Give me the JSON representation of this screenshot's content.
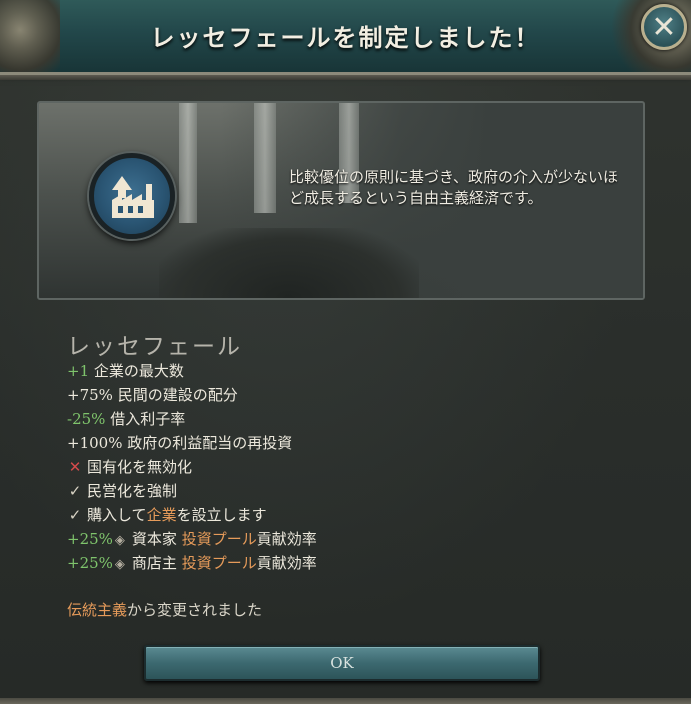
{
  "header": {
    "title": "レッセフェールを制定しました！",
    "close_icon": "close-icon"
  },
  "description": {
    "text": "比較優位の原則に基づき、政府の介入が少ないほど成長するという自由主義経済です。",
    "badge_icon": "factory-growth-icon"
  },
  "law": {
    "name": "レッセフェール",
    "effects": [
      {
        "prefix": "+1",
        "prefix_color": "pos",
        "text": "企業の最大数"
      },
      {
        "prefix": "+75%",
        "prefix_color": "neu",
        "text": "民間の建設の配分"
      },
      {
        "prefix": "-25%",
        "prefix_color": "pos",
        "text": "借入利子率"
      },
      {
        "prefix": "+100%",
        "prefix_color": "neu",
        "text": "政府の利益配当の再投資"
      },
      {
        "icon": "cross-icon",
        "text": "国有化を無効化"
      },
      {
        "icon": "check-icon",
        "text": "民営化を強制"
      },
      {
        "icon": "check-icon",
        "text_before": "購入して",
        "highlight": "企業",
        "text_after": "を設立します"
      },
      {
        "prefix": "+25%",
        "prefix_color": "pos",
        "pop_icon": "capitalist-icon",
        "text_before": "資本家",
        "highlight": "投資プール",
        "text_after": "貢献効率"
      },
      {
        "prefix": "+25%",
        "prefix_color": "pos",
        "pop_icon": "shopkeeper-icon",
        "text_before": "商店主",
        "highlight": "投資プール",
        "text_after": "貢献効率"
      }
    ]
  },
  "changed": {
    "highlight": "伝統主義",
    "text": "から変更されました"
  },
  "ok_button": {
    "label": "OK"
  },
  "colors": {
    "positive": "#7fc46c",
    "highlight": "#e69b5a",
    "negative_icon": "#d34b4b",
    "header_teal": "#22474a"
  }
}
